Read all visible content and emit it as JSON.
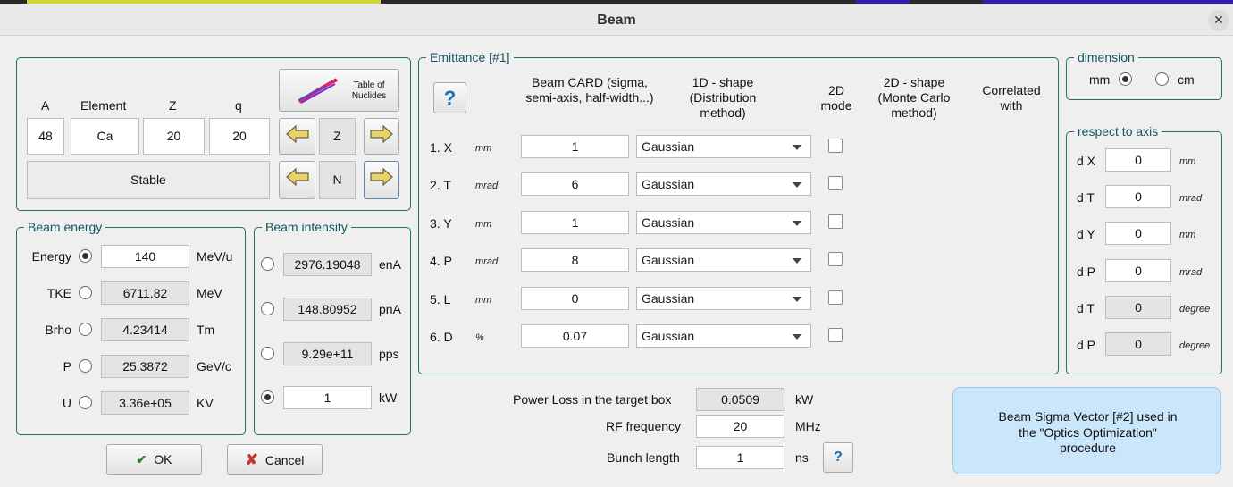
{
  "window": {
    "title": "Beam",
    "close_glyph": "✕"
  },
  "nuclide": {
    "headers": {
      "a": "A",
      "element": "Element",
      "z": "Z",
      "q": "q"
    },
    "values": {
      "a": "48",
      "element": "Ca",
      "z": "20",
      "q": "20"
    },
    "status": "Stable",
    "table_button": "Table of Nuclides",
    "z_label": "Z",
    "n_label": "N"
  },
  "energy": {
    "legend": "Beam energy",
    "rows": [
      {
        "label": "Energy",
        "value": "140",
        "unit": "MeV/u",
        "selected": true
      },
      {
        "label": "TKE",
        "value": "6711.82",
        "unit": "MeV",
        "selected": false
      },
      {
        "label": "Brho",
        "value": "4.23414",
        "unit": "Tm",
        "selected": false
      },
      {
        "label": "P",
        "value": "25.3872",
        "unit": "GeV/c",
        "selected": false
      },
      {
        "label": "U",
        "value": "3.36e+05",
        "unit": "KV",
        "selected": false
      }
    ]
  },
  "intensity": {
    "legend": "Beam intensity",
    "rows": [
      {
        "value": "2976.19048",
        "unit": "enA",
        "selected": false
      },
      {
        "value": "148.80952",
        "unit": "pnA",
        "selected": false
      },
      {
        "value": "9.29e+11",
        "unit": "pps",
        "selected": false
      },
      {
        "value": "1",
        "unit": "kW",
        "selected": true
      }
    ]
  },
  "buttons": {
    "ok": "OK",
    "cancel": "Cancel",
    "help": "?"
  },
  "emittance": {
    "legend": "Emittance [#1]",
    "col_card": "Beam CARD (sigma, semi-axis, half-width...)",
    "col_1d": "1D - shape (Distribution method)",
    "col_2dmode": "2D mode",
    "col_2dshape": "2D - shape (Monte Carlo method)",
    "col_corr": "Correlated with",
    "rows": [
      {
        "label": "1. X",
        "unit": "mm",
        "value": "1",
        "shape": "Gaussian"
      },
      {
        "label": "2. T",
        "unit": "mrad",
        "value": "6",
        "shape": "Gaussian"
      },
      {
        "label": "3. Y",
        "unit": "mm",
        "value": "1",
        "shape": "Gaussian"
      },
      {
        "label": "4. P",
        "unit": "mrad",
        "value": "8",
        "shape": "Gaussian"
      },
      {
        "label": "5. L",
        "unit": "mm",
        "value": "0",
        "shape": "Gaussian"
      },
      {
        "label": "6. D",
        "unit": "%",
        "value": "0.07",
        "shape": "Gaussian"
      }
    ]
  },
  "dimension": {
    "legend": "dimension",
    "mm": "mm",
    "cm": "cm",
    "selected": "mm"
  },
  "axis": {
    "legend": "respect to axis",
    "rows": [
      {
        "label": "d X",
        "value": "0",
        "unit": "mm",
        "readonly": false
      },
      {
        "label": "d T",
        "value": "0",
        "unit": "mrad",
        "readonly": false
      },
      {
        "label": "d Y",
        "value": "0",
        "unit": "mm",
        "readonly": false
      },
      {
        "label": "d P",
        "value": "0",
        "unit": "mrad",
        "readonly": false
      },
      {
        "label": "d T",
        "value": "0",
        "unit": "degree",
        "readonly": true
      },
      {
        "label": "d P",
        "value": "0",
        "unit": "degree",
        "readonly": true
      }
    ]
  },
  "power": {
    "label": "Power  Loss in the target box",
    "value": "0.0509",
    "unit": "kW",
    "rf_label": "RF frequency",
    "rf_value": "20",
    "rf_unit": "MHz",
    "bunch_label": "Bunch length",
    "bunch_value": "1",
    "bunch_unit": "ns"
  },
  "sigma_vector": {
    "text": "Beam Sigma Vector [#2] used in the \"Optics Optimization\" procedure"
  },
  "colors": {
    "frame": "#1e7550",
    "legend": "#16545e",
    "help": "#1b6fb3",
    "cancel": "#c0392b",
    "ok": "#2a8a2a"
  }
}
